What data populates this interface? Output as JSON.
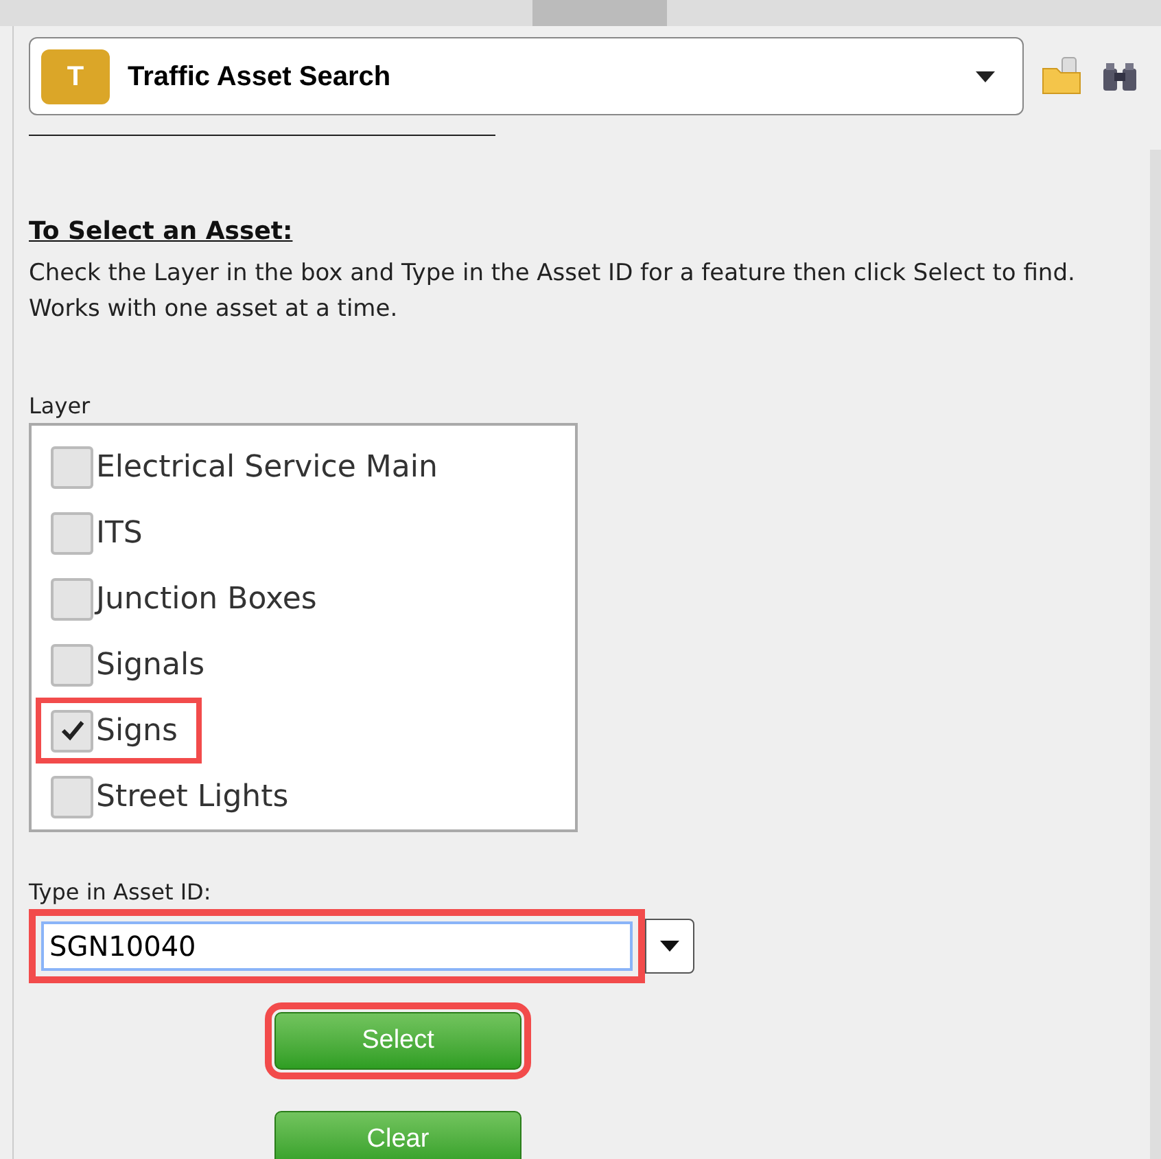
{
  "header": {
    "badge": "T",
    "title": "Traffic Asset Search"
  },
  "instructions": {
    "heading": "To Select an Asset:",
    "text": "Check the Layer in the box and Type in the Asset ID for a feature then click Select to find. Works with one asset at a time."
  },
  "layer": {
    "label": "Layer",
    "items": [
      {
        "label": "Electrical Service Main",
        "checked": false,
        "highlighted": false
      },
      {
        "label": "ITS",
        "checked": false,
        "highlighted": false
      },
      {
        "label": "Junction Boxes",
        "checked": false,
        "highlighted": false
      },
      {
        "label": "Signals",
        "checked": false,
        "highlighted": false
      },
      {
        "label": "Signs",
        "checked": true,
        "highlighted": true
      },
      {
        "label": "Street Lights",
        "checked": false,
        "highlighted": false
      }
    ]
  },
  "asset_id": {
    "label": "Type in Asset ID:",
    "value": "SGN10040",
    "highlighted": true
  },
  "buttons": [
    {
      "label": "Select",
      "highlighted": true
    },
    {
      "label": "Clear",
      "highlighted": false
    }
  ]
}
